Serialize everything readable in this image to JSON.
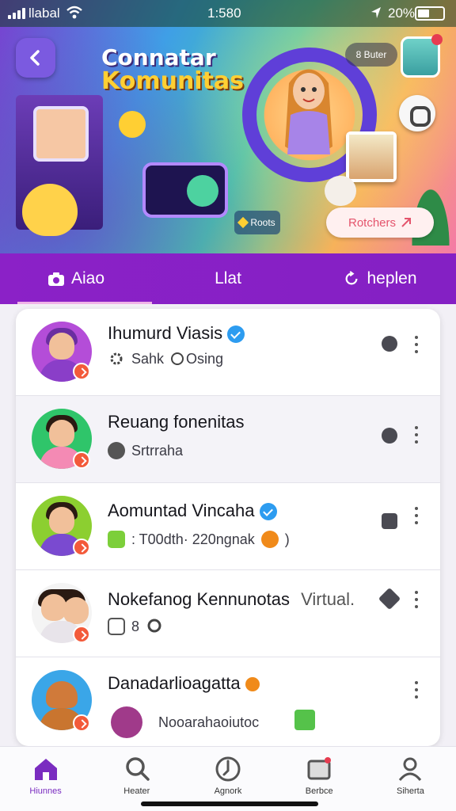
{
  "status_bar": {
    "carrier": "llabal",
    "time": "1:580",
    "battery": "20%"
  },
  "hero": {
    "title_line1": "Connatar",
    "title_line2": "Komunitas",
    "chip": "8 Buter",
    "tag": "Roots",
    "pill": "Rotchers"
  },
  "tabs": [
    {
      "label": "Aiao",
      "icon": "camera-icon",
      "active": true
    },
    {
      "label": "Llat",
      "icon": "",
      "active": false
    },
    {
      "label": "heplen",
      "icon": "refresh-icon",
      "active": false
    }
  ],
  "list": [
    {
      "title": "Ihumurd Viasis",
      "verified": true,
      "sub1": "Sahk",
      "sub2": "Osing",
      "avatar_color": "#b44dd8"
    },
    {
      "title": "Reuang fonenitas",
      "verified": false,
      "sub1": "Srtrraha",
      "sub2": "",
      "avatar_color": "#2fc56a"
    },
    {
      "title": "Aomuntad Vincaha",
      "verified": true,
      "sub1": ": T00dth· 220ngnak",
      "sub2": ")",
      "avatar_color": "#8ccf30"
    },
    {
      "title": "Nokefanog Kennunotas",
      "verified": false,
      "sub1": "8",
      "sub2": "",
      "extra": "Virtual.",
      "avatar_color": "#f4f4f4"
    },
    {
      "title": "Danadarlioagatta",
      "verified": false,
      "sub1": "Nooarahaoiutoc",
      "sub2": "",
      "avatar_color": "#3aa6e8"
    }
  ],
  "bottom_nav": [
    {
      "label": "Hiunnes",
      "icon": "home-icon",
      "active": true
    },
    {
      "label": "Heater",
      "icon": "search-icon",
      "active": false
    },
    {
      "label": "Agnork",
      "icon": "compass-icon",
      "active": false
    },
    {
      "label": "Berbce",
      "icon": "inbox-icon",
      "active": false
    },
    {
      "label": "Siherta",
      "icon": "profile-icon",
      "active": false
    }
  ],
  "colors": {
    "tab_bar": "#8b21c7",
    "accent": "#7a2cc0",
    "verified": "#2d9cf0",
    "badge": "#f35a3a"
  }
}
